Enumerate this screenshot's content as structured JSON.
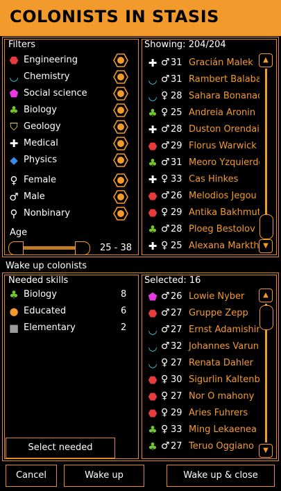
{
  "window": {
    "title": "COLONISTS IN STASIS"
  },
  "filters": {
    "heading": "Filters",
    "skills": [
      {
        "icon": "engineering-icon",
        "glyph": "⬣",
        "color": "#e83a3a",
        "label": "Engineering"
      },
      {
        "icon": "chemistry-icon",
        "glyph": "◡",
        "color": "#33d6e8",
        "label": "Chemistry"
      },
      {
        "icon": "social-science-icon",
        "glyph": "⬟",
        "color": "#e83ae0",
        "label": "Social science"
      },
      {
        "icon": "biology-icon",
        "glyph": "♣",
        "color": "#6fc62e",
        "label": "Biology"
      },
      {
        "icon": "geology-icon",
        "glyph": "⛉",
        "color": "#f0e21e",
        "label": "Geology"
      },
      {
        "icon": "medical-icon",
        "glyph": "✚",
        "color": "#ffffff",
        "label": "Medical"
      },
      {
        "icon": "physics-icon",
        "glyph": "◆",
        "color": "#3a8ee8",
        "label": "Physics"
      }
    ],
    "genders": [
      {
        "icon": "female-icon",
        "glyph": "♀",
        "label": "Female"
      },
      {
        "icon": "male-icon",
        "glyph": "♂",
        "label": "Male"
      },
      {
        "icon": "nonbinary-icon",
        "glyph": "⚲",
        "label": "Nonbinary"
      }
    ],
    "age_label": "Age",
    "age_range": "25 - 38"
  },
  "colonists": {
    "showing_label": "Showing: 204/204",
    "rows": [
      {
        "icon": "medical-icon",
        "glyph": "✚",
        "color": "#ffffff",
        "gender": "♂",
        "age": "31",
        "name": "Gracián Malek"
      },
      {
        "icon": "chemistry-icon",
        "glyph": "◡",
        "color": "#33d6e8",
        "gender": "♂",
        "age": "31",
        "name": "Rambert Balabaı"
      },
      {
        "icon": "chemistry-icon",
        "glyph": "◡",
        "color": "#33d6e8",
        "gender": "♀",
        "age": "28",
        "name": "Sahara Bonanad"
      },
      {
        "icon": "biology-icon",
        "glyph": "♣",
        "color": "#6fc62e",
        "gender": "♀",
        "age": "25",
        "name": "Andreia Aronin"
      },
      {
        "icon": "medical-icon",
        "glyph": "✚",
        "color": "#ffffff",
        "gender": "♂",
        "age": "28",
        "name": "Duston Orendair"
      },
      {
        "icon": "engineering-icon",
        "glyph": "⬣",
        "color": "#e83a3a",
        "gender": "♂",
        "age": "29",
        "name": "Florus Warwick"
      },
      {
        "icon": "biology-icon",
        "glyph": "♣",
        "color": "#6fc62e",
        "gender": "♂",
        "age": "31",
        "name": "Meoro Yzquierdo"
      },
      {
        "icon": "medical-icon",
        "glyph": "✚",
        "color": "#ffffff",
        "gender": "♀",
        "age": "33",
        "name": "Cas Hinkes"
      },
      {
        "icon": "engineering-icon",
        "glyph": "⬣",
        "color": "#e83a3a",
        "gender": "♂",
        "age": "26",
        "name": "Melodios Jegou"
      },
      {
        "icon": "engineering-icon",
        "glyph": "⬣",
        "color": "#e83a3a",
        "gender": "♀",
        "age": "29",
        "name": "Antika Bakhmut"
      },
      {
        "icon": "biology-icon",
        "glyph": "♣",
        "color": "#6fc62e",
        "gender": "♂",
        "age": "28",
        "name": "Ploeg Bestolov"
      },
      {
        "icon": "medical-icon",
        "glyph": "✚",
        "color": "#ffffff",
        "gender": "♀",
        "age": "25",
        "name": "Alexana Markth"
      }
    ]
  },
  "wake": {
    "heading": "Wake up colonists",
    "needed_heading": "Needed skills",
    "needed": [
      {
        "icon": "biology-icon",
        "glyph": "♣",
        "color": "#6fc62e",
        "label": "Biology",
        "count": "8"
      },
      {
        "icon": "educated-icon",
        "glyph": "●",
        "color": "#f39a2c",
        "label": "Educated",
        "count": "6"
      },
      {
        "icon": "elementary-icon",
        "glyph": "■",
        "color": "#9a9a9a",
        "label": "Elementary",
        "count": "2"
      }
    ],
    "select_needed_label": "Select needed",
    "selected_label": "Selected: 16",
    "selected_rows": [
      {
        "icon": "social-science-icon",
        "glyph": "⬟",
        "color": "#e83ae0",
        "gender": "♂",
        "age": "26",
        "name": "Lowie Nyber"
      },
      {
        "icon": "engineering-icon",
        "glyph": "⬣",
        "color": "#e83a3a",
        "gender": "♂",
        "age": "27",
        "name": "Gruppe Zepp"
      },
      {
        "icon": "chemistry-icon",
        "glyph": "◡",
        "color": "#33d6e8",
        "gender": "♂",
        "age": "27",
        "name": "Ernst Adamishin"
      },
      {
        "icon": "chemistry-icon",
        "glyph": "◡",
        "color": "#33d6e8",
        "gender": "♂",
        "age": "32",
        "name": "Johannes Varun"
      },
      {
        "icon": "chemistry-icon",
        "glyph": "◡",
        "color": "#33d6e8",
        "gender": "♀",
        "age": "27",
        "name": "Renata Dahler"
      },
      {
        "icon": "engineering-icon",
        "glyph": "⬣",
        "color": "#e83a3a",
        "gender": "♀",
        "age": "30",
        "name": "Sigurlin Kaltenbo"
      },
      {
        "icon": "engineering-icon",
        "glyph": "⬣",
        "color": "#e83a3a",
        "gender": "♀",
        "age": "27",
        "name": "Nor O mahony"
      },
      {
        "icon": "engineering-icon",
        "glyph": "⬣",
        "color": "#e83a3a",
        "gender": "♀",
        "age": "29",
        "name": "Aries Fuhrers"
      },
      {
        "icon": "biology-icon",
        "glyph": "♣",
        "color": "#6fc62e",
        "gender": "♀",
        "age": "33",
        "name": "Ming Lekaenea"
      },
      {
        "icon": "biology-icon",
        "glyph": "♣",
        "color": "#6fc62e",
        "gender": "♂",
        "age": "27",
        "name": "Teruo Oggiano"
      }
    ]
  },
  "footer": {
    "cancel_label": "Cancel",
    "wake_label": "Wake up",
    "wake_close_label": "Wake up & close"
  }
}
